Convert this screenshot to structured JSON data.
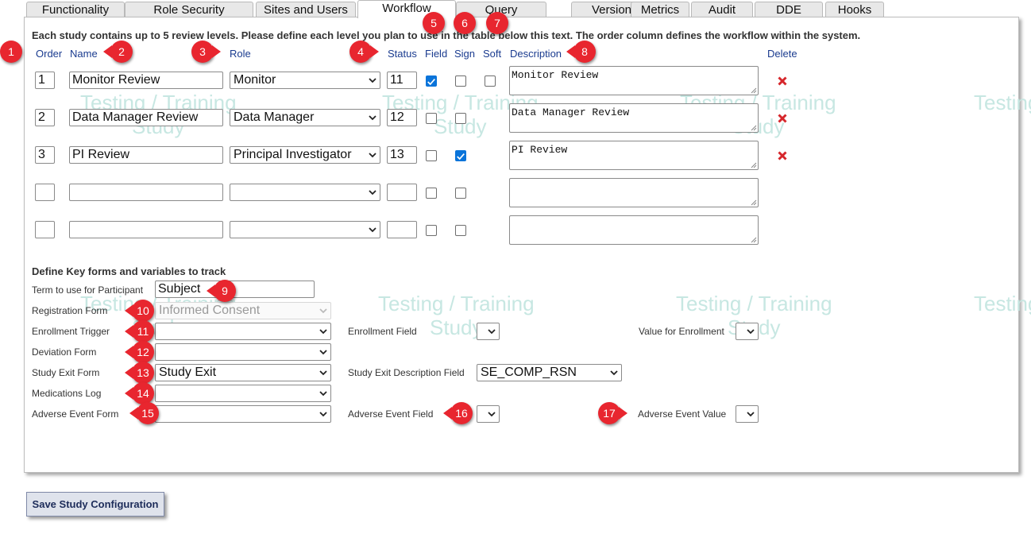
{
  "tabs": [
    {
      "label": "Functionality",
      "active": false
    },
    {
      "label": "Role Security",
      "active": false
    },
    {
      "label": "Sites and Users",
      "active": false
    },
    {
      "label": "Workflow",
      "active": true
    },
    {
      "label": "Query",
      "active": false
    },
    {
      "label": "Version",
      "active": false
    },
    {
      "label": "Metrics",
      "active": false
    },
    {
      "label": "Audit",
      "active": false
    },
    {
      "label": "DDE",
      "active": false
    },
    {
      "label": "Hooks",
      "active": false
    }
  ],
  "workflow": {
    "intro": "Each study contains up to 5 review levels. Please define each level you plan to use in the table below this text. The order column defines the workflow within the system.",
    "headers": {
      "order": "Order",
      "name": "Name",
      "role": "Role",
      "status": "Status",
      "field": "Field",
      "sign": "Sign",
      "soft": "Soft",
      "description": "Description",
      "delete": "Delete"
    },
    "rows": [
      {
        "order": "1",
        "name": "Monitor Review",
        "role": "Monitor",
        "status": "11",
        "field": true,
        "sign": false,
        "soft": false,
        "description": "Monitor Review",
        "deletable": true
      },
      {
        "order": "2",
        "name": "Data Manager Review",
        "role": "Data Manager",
        "status": "12",
        "field": false,
        "sign": false,
        "soft": null,
        "description": "Data Manager Review",
        "deletable": true
      },
      {
        "order": "3",
        "name": "PI Review",
        "role": "Principal Investigator",
        "status": "13",
        "field": false,
        "sign": true,
        "soft": null,
        "description": "PI Review",
        "deletable": true
      },
      {
        "order": "",
        "name": "",
        "role": "",
        "status": "",
        "field": false,
        "sign": false,
        "soft": null,
        "description": "",
        "deletable": false
      },
      {
        "order": "",
        "name": "",
        "role": "",
        "status": "",
        "field": false,
        "sign": false,
        "soft": null,
        "description": "",
        "deletable": false
      }
    ]
  },
  "key_forms": {
    "heading": "Define Key forms and variables to track",
    "participant_term_label": "Term to use for Participant",
    "participant_term_value": "Subject",
    "registration_form_label": "Registration Form",
    "registration_form_value": "Informed Consent",
    "enrollment_trigger_label": "Enrollment Trigger",
    "enrollment_trigger_value": "",
    "enrollment_field_label": "Enrollment Field",
    "enrollment_field_value": "",
    "value_for_enrollment_label": "Value for Enrollment",
    "value_for_enrollment_value": "",
    "deviation_form_label": "Deviation Form",
    "deviation_form_value": "",
    "study_exit_form_label": "Study Exit Form",
    "study_exit_form_value": "Study Exit",
    "study_exit_desc_field_label": "Study Exit Description Field",
    "study_exit_desc_field_value": "SE_COMP_RSN",
    "medications_log_label": "Medications Log",
    "medications_log_value": "",
    "adverse_event_form_label": "Adverse Event Form",
    "adverse_event_form_value": "",
    "adverse_event_field_label": "Adverse Event Field",
    "adverse_event_field_value": "",
    "adverse_event_value_label": "Adverse Event Value",
    "adverse_event_value_value": ""
  },
  "watermark": {
    "line1": "Testing / Training",
    "line2": "Study"
  },
  "callouts": [
    "1",
    "2",
    "3",
    "4",
    "5",
    "6",
    "7",
    "8",
    "9",
    "10",
    "11",
    "12",
    "13",
    "14",
    "15",
    "16",
    "17"
  ],
  "save_button": "Save Study Configuration",
  "colors": {
    "accent_blue": "#1a3b8f",
    "callout_red": "#e8262f",
    "delete_red": "#d6262b",
    "checkbox_blue": "#0a74da",
    "watermark": "#c7e7e2"
  }
}
